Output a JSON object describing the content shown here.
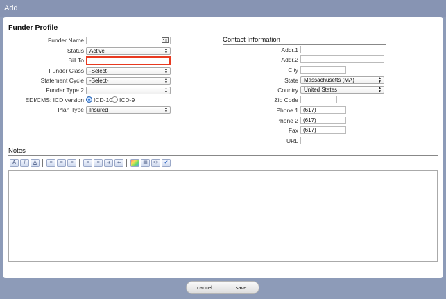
{
  "window": {
    "title": "Add"
  },
  "funder": {
    "section_title": "Funder Profile",
    "name": {
      "label": "Funder Name",
      "value": ""
    },
    "status": {
      "label": "Status",
      "value": "Active"
    },
    "bill_to": {
      "label": "Bill To",
      "value": ""
    },
    "funder_class": {
      "label": "Funder Class",
      "value": "-Select-"
    },
    "statement_cycle": {
      "label": "Statement Cycle",
      "value": "-Select-"
    },
    "funder_type2": {
      "label": "Funder Type 2",
      "value": ""
    },
    "icd": {
      "label": "EDI/CMS: ICD version",
      "opt1": "ICD-10",
      "opt2": "ICD-9",
      "selected": "ICD-10"
    },
    "plan_type": {
      "label": "Plan Type",
      "value": "Insured"
    }
  },
  "contact": {
    "section_title": "Contact Information",
    "addr1": {
      "label": "Addr.1",
      "value": ""
    },
    "addr2": {
      "label": "Addr.2",
      "value": ""
    },
    "city": {
      "label": "City",
      "value": ""
    },
    "state": {
      "label": "State",
      "value": "Massachusetts (MA)"
    },
    "country": {
      "label": "Country",
      "value": "United States"
    },
    "zip": {
      "label": "Zip Code",
      "value": ""
    },
    "phone1": {
      "label": "Phone 1",
      "value": "(617)"
    },
    "phone2": {
      "label": "Phone 2",
      "value": "(617)"
    },
    "fax": {
      "label": "Fax",
      "value": "(617)"
    },
    "url": {
      "label": "URL",
      "value": ""
    }
  },
  "notes": {
    "section_title": "Notes",
    "toolbar": {
      "bold": "A",
      "italic": "I",
      "underline": "A"
    }
  },
  "footer": {
    "cancel": "cancel",
    "save": "save"
  },
  "colors": {
    "accent": "#8794b3",
    "highlight": "#e8391f",
    "radio": "#2f7de1"
  }
}
